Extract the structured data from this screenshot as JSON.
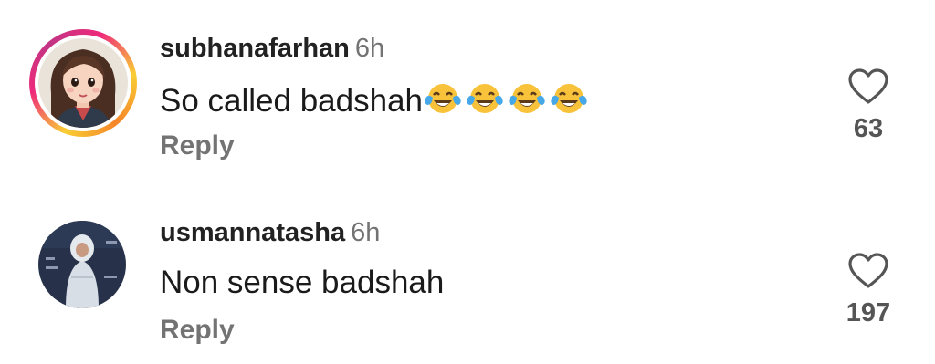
{
  "comments": [
    {
      "username": "subhanafarhan",
      "time": "6h",
      "text": "So called badshah",
      "emoji_icons": [
        "face-with-tears-of-joy-icon",
        "face-with-tears-of-joy-icon",
        "face-with-tears-of-joy-icon",
        "face-with-tears-of-joy-icon"
      ],
      "reply_label": "Reply",
      "like_count": "63",
      "has_story_ring": true
    },
    {
      "username": "usmannatasha",
      "time": "6h",
      "text": "Non sense badshah",
      "reply_label": "Reply",
      "like_count": "197",
      "has_story_ring": false
    }
  ],
  "colors": {
    "story_ring": [
      "#f9ce34",
      "#ee2a7b",
      "#c13584",
      "#f58529"
    ],
    "muted_text": "#737373",
    "emoji_yellow": "#f8c33a",
    "emoji_tears": "#47a8e8"
  }
}
